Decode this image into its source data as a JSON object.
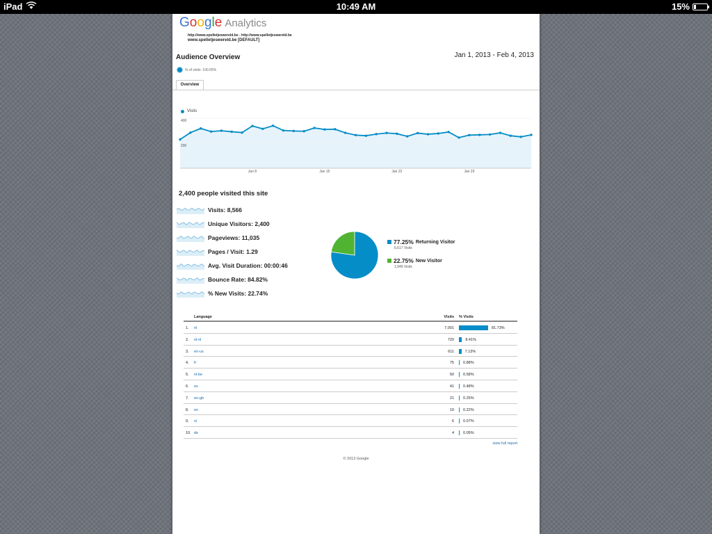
{
  "status_bar": {
    "device": "iPad",
    "time": "10:49 AM",
    "battery_percent": "15%",
    "battery_level": 0.15
  },
  "header": {
    "logo_word": "Google",
    "product": "Analytics",
    "property_url": "http://www.spelletjeswereld.be - http://www.spelletjeswereld.be",
    "property_view": "www.spelletjeswereld.be [DEFAULT]"
  },
  "report": {
    "title": "Audience Overview",
    "date_range": "Jan 1, 2013 - Feb 4, 2013",
    "segment_label": "% of visits: 100.00%",
    "tab": "Overview"
  },
  "colors": {
    "primary": "#058dc7",
    "secondary": "#50b432",
    "chart_fill": "#e6f3fa",
    "link": "#1a6bb0"
  },
  "chart_data": {
    "type": "area",
    "legend": "Visits",
    "y_ticks": [
      "400",
      "200"
    ],
    "y_tick_values": [
      400,
      200
    ],
    "x_ticks": [
      "Jan 8",
      "Jan 15",
      "Jan 22",
      "Jan 29"
    ],
    "x_tick_index": [
      7,
      14,
      21,
      28
    ],
    "ylim": [
      0,
      400
    ],
    "x": [
      "Jan 1",
      "Jan 2",
      "Jan 3",
      "Jan 4",
      "Jan 5",
      "Jan 6",
      "Jan 7",
      "Jan 8",
      "Jan 9",
      "Jan 10",
      "Jan 11",
      "Jan 12",
      "Jan 13",
      "Jan 14",
      "Jan 15",
      "Jan 16",
      "Jan 17",
      "Jan 18",
      "Jan 19",
      "Jan 20",
      "Jan 21",
      "Jan 22",
      "Jan 23",
      "Jan 24",
      "Jan 25",
      "Jan 26",
      "Jan 27",
      "Jan 28",
      "Jan 29",
      "Jan 30",
      "Jan 31",
      "Feb 1",
      "Feb 2",
      "Feb 3",
      "Feb 4"
    ],
    "values": [
      230,
      285,
      318,
      293,
      300,
      292,
      285,
      338,
      315,
      340,
      302,
      298,
      296,
      322,
      310,
      312,
      283,
      265,
      260,
      273,
      282,
      276,
      255,
      281,
      272,
      278,
      290,
      245,
      265,
      267,
      270,
      283,
      260,
      251,
      267
    ]
  },
  "summary": {
    "headline": "2,400 people visited this site",
    "metrics": [
      {
        "label": "Visits:",
        "value": "8,566"
      },
      {
        "label": "Unique Visitors:",
        "value": "2,400"
      },
      {
        "label": "Pageviews:",
        "value": "11,035"
      },
      {
        "label": "Pages / Visit:",
        "value": "1.29"
      },
      {
        "label": "Avg. Visit Duration:",
        "value": "00:00:46"
      },
      {
        "label": "Bounce Rate:",
        "value": "84.82%"
      },
      {
        "label": "% New Visits:",
        "value": "22.74%"
      }
    ]
  },
  "pie_chart": {
    "type": "pie",
    "slices": [
      {
        "name": "Returning Visitor",
        "percent": "77.25%",
        "value": 77.25,
        "visits": "6,617 Visits",
        "color": "#058dc7"
      },
      {
        "name": "New Visitor",
        "percent": "22.75%",
        "value": 22.75,
        "visits": "1,949 Visits",
        "color": "#50b432"
      }
    ]
  },
  "language_table": {
    "headers": {
      "language": "Language",
      "visits": "Visits",
      "pct": "% Visits"
    },
    "rows": [
      {
        "rank": "1.",
        "language": "nl",
        "visits": "7,001",
        "pct": "81.73%",
        "share": 81.73
      },
      {
        "rank": "2.",
        "language": "nl-nl",
        "visits": "720",
        "pct": "8.41%",
        "share": 8.41
      },
      {
        "rank": "3.",
        "language": "en-us",
        "visits": "611",
        "pct": "7.13%",
        "share": 7.13
      },
      {
        "rank": "4.",
        "language": "fr",
        "visits": "75",
        "pct": "0.88%",
        "share": 0.88
      },
      {
        "rank": "5.",
        "language": "nl-be",
        "visits": "50",
        "pct": "0.58%",
        "share": 0.58
      },
      {
        "rank": "6.",
        "language": "es",
        "visits": "41",
        "pct": "0.48%",
        "share": 0.48
      },
      {
        "rank": "7.",
        "language": "en-gb",
        "visits": "21",
        "pct": "0.25%",
        "share": 0.25
      },
      {
        "rank": "8.",
        "language": "en",
        "visits": "19",
        "pct": "0.22%",
        "share": 0.22
      },
      {
        "rank": "9.",
        "language": "sl",
        "visits": "6",
        "pct": "0.07%",
        "share": 0.07
      },
      {
        "rank": "10.",
        "language": "de",
        "visits": "4",
        "pct": "0.05%",
        "share": 0.05
      }
    ],
    "view_full_report": "view full report"
  },
  "footer": {
    "copyright": "© 2013 Google"
  }
}
